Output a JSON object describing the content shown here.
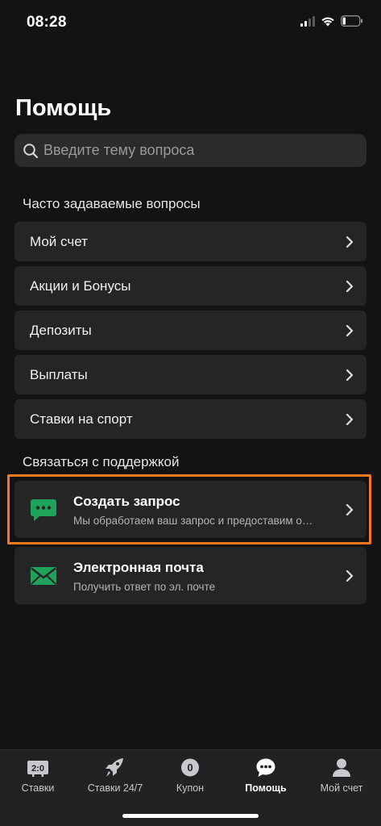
{
  "status_bar": {
    "time": "08:28"
  },
  "page": {
    "title": "Помощь"
  },
  "search": {
    "placeholder": "Введите тему вопроса"
  },
  "faq": {
    "title": "Часто задаваемые вопросы",
    "items": [
      {
        "label": "Мой счет"
      },
      {
        "label": "Акции и Бонусы"
      },
      {
        "label": "Депозиты"
      },
      {
        "label": "Выплаты"
      },
      {
        "label": "Ставки на спорт"
      }
    ]
  },
  "support": {
    "title": "Связаться с поддержкой",
    "request": {
      "title": "Создать запрос",
      "subtitle": "Мы обработаем ваш запрос и предоставим о…",
      "icon": "chat-bubble-icon"
    },
    "email": {
      "title": "Электронная почта",
      "subtitle": "Получить ответ по эл. почте",
      "icon": "envelope-icon"
    }
  },
  "tabbar": {
    "tabs": [
      {
        "label": "Ставки",
        "badge": "2:0",
        "icon": "scoreboard-icon"
      },
      {
        "label": "Ставки 24/7",
        "icon": "rocket-icon"
      },
      {
        "label": "Купон",
        "badge": "0",
        "icon": "coupon-icon"
      },
      {
        "label": "Помощь",
        "icon": "help-chat-icon",
        "active": true
      },
      {
        "label": "Мой счет",
        "icon": "user-icon"
      }
    ]
  },
  "colors": {
    "accent_green": "#1fa25a",
    "highlight_orange": "#f47a20",
    "background": "#131313",
    "row_bg": "#252527"
  }
}
